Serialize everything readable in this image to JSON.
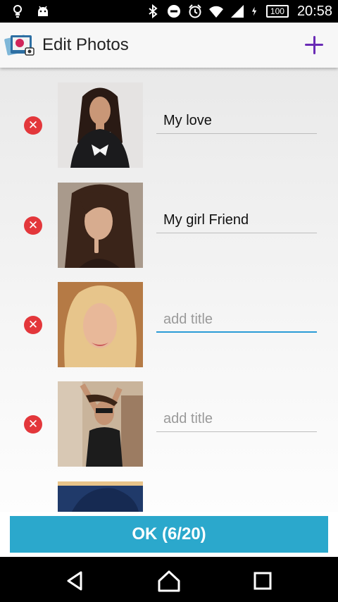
{
  "status_bar": {
    "time": "20:58",
    "battery": "100",
    "icons": [
      "lightbulb-icon",
      "android-icon",
      "bluetooth-icon",
      "do-not-disturb-icon",
      "alarm-icon",
      "wifi-icon",
      "signal-icon",
      "charging-icon"
    ]
  },
  "action_bar": {
    "title": "Edit Photos",
    "add_icon": "plus-icon",
    "accent_color": "#6a2bb5"
  },
  "photos": [
    {
      "title": "My love",
      "placeholder": "add title"
    },
    {
      "title": "My girl Friend",
      "placeholder": "add title"
    },
    {
      "title": "",
      "placeholder": "add title",
      "focused": true
    },
    {
      "title": "",
      "placeholder": "add title"
    }
  ],
  "ok_button": {
    "label": "OK (6/20)",
    "color": "#2ba8cc"
  },
  "nav_bar": {
    "icons": [
      "back-icon",
      "home-icon",
      "recents-icon"
    ]
  }
}
